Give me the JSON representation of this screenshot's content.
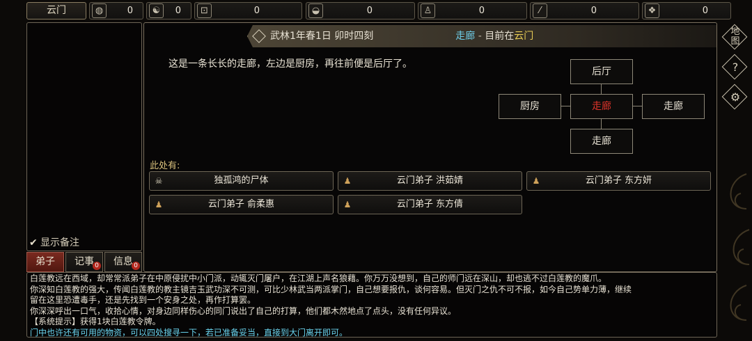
{
  "topbar": {
    "sect_name": "云门",
    "resources": [
      {
        "icon": "coin-pouch-icon",
        "glyph": "◍",
        "value": "0"
      },
      {
        "icon": "yin-yang-icon",
        "glyph": "☯",
        "value": "0"
      },
      {
        "icon": "square-coin-icon",
        "glyph": "⊡",
        "value": "0"
      },
      {
        "icon": "rice-bowl-icon",
        "glyph": "◒",
        "value": "0"
      },
      {
        "icon": "medicine-bottle-icon",
        "glyph": "♙",
        "value": "0"
      },
      {
        "icon": "scroll-icon",
        "glyph": "⁄",
        "value": "0"
      },
      {
        "icon": "ore-icon",
        "glyph": "❖",
        "value": "0"
      }
    ]
  },
  "header": {
    "date": "武林1年春1日 卯时四刻",
    "location": "走廊",
    "dash": "-",
    "currently_at": "目前在",
    "sect": "云门"
  },
  "description": "这是一条长长的走廊，左边是厨房，再往前便是后厅了。",
  "map": {
    "north": "后厅",
    "west": "厨房",
    "center": "走廊",
    "east": "走廊",
    "south": "走廊"
  },
  "here_label": "此处有:",
  "entities": [
    {
      "icon": "skull-icon",
      "glyph": "☠",
      "label": "独孤鸿的尸体"
    },
    {
      "icon": "person-icon",
      "glyph": "♟",
      "label": "云门弟子 洪茹婧"
    },
    {
      "icon": "person-icon",
      "glyph": "♟",
      "label": "云门弟子 东方妍"
    },
    {
      "icon": "person-icon",
      "glyph": "♟",
      "label": "云门弟子 俞柔惠"
    },
    {
      "icon": "person-icon",
      "glyph": "♟",
      "label": "云门弟子 东方倩"
    }
  ],
  "left": {
    "show_notes": "显示备注",
    "tabs": [
      {
        "label": "弟子",
        "badge": ""
      },
      {
        "label": "记事",
        "badge": "0"
      },
      {
        "label": "信息",
        "badge": "0"
      }
    ]
  },
  "side": {
    "map_label": "地图",
    "help_glyph": "?",
    "settings_glyph": "⚙"
  },
  "log": [
    "白莲教远在西域，却常常派弟子在中原侵扰中小门派，动辄灭门屠户，在江湖上声名狼藉。你万万没想到，自己的师门远在深山，却也逃不过白莲教的魔爪。",
    "你深知白莲教的强大，传闻白莲教的教主镜吉玉武功深不可测，可比少林武当两派掌门，自己想要报仇，谈何容易。但灭门之仇不可不报，如今自己势单力薄，继续",
    "留在这里恐遭毒手，还是先找到一个安身之处，再作打算罢。",
    "你深深呼出一口气，收拾心情，对身边同样伤心的同门说出了自己的打算，他们都木然地点了点头，没有任何异议。",
    "【系统提示】获得1块白莲教令牌。",
    "门中也许还有可用的物资，可以四处搜寻一下，若已准备妥当，直接到大门离开即可。"
  ],
  "colors": {
    "location": "#6fd0ec",
    "sect": "#e8cc55",
    "current_room": "#e0342a",
    "system_line": "#6ad4ee"
  }
}
